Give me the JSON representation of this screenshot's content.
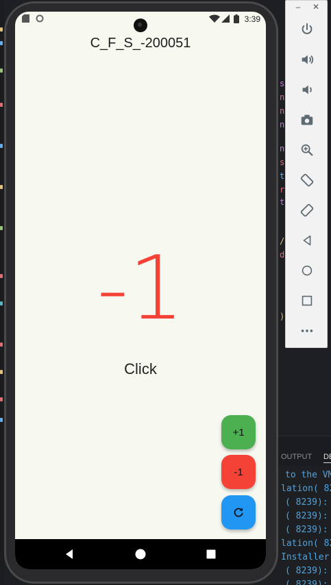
{
  "app": {
    "title": "C_F_S_-200051",
    "counter_value": "-1",
    "counter_color": "#f44336",
    "click_label": "Click"
  },
  "status_bar": {
    "time": "3:39",
    "left_icons": [
      "sd-card-icon",
      "circle-status-icon"
    ],
    "right_icons": [
      "wifi-icon",
      "signal-icon",
      "battery-icon"
    ]
  },
  "fabs": [
    {
      "label": "+1",
      "color": "#4caf50",
      "name": "increment-button"
    },
    {
      "label": "-1",
      "color": "#f44336",
      "name": "decrement-button"
    },
    {
      "icon": "refresh-icon",
      "color": "#2196f3",
      "name": "reset-button"
    }
  ],
  "nav_bar": [
    "back-icon",
    "home-icon",
    "recents-icon"
  ],
  "emulator_toolbar": {
    "window_controls": [
      "minimize-icon",
      "close-icon"
    ],
    "buttons": [
      "power-icon",
      "volume-up-icon",
      "volume-down-icon",
      "camera-icon",
      "zoom-icon",
      "rotate-left-icon",
      "rotate-right-icon",
      "back-icon",
      "home-icon",
      "overview-icon",
      "more-icon"
    ]
  },
  "ide": {
    "panel_tabs": [
      "OUTPUT",
      "DE"
    ],
    "console_lines": [
      "to the VM",
      "lation( 82",
      "( 8239):",
      "( 8239):",
      "( 8239):",
      "lation( 82",
      "Installer(",
      "( 8239):",
      "( 8239):"
    ]
  }
}
